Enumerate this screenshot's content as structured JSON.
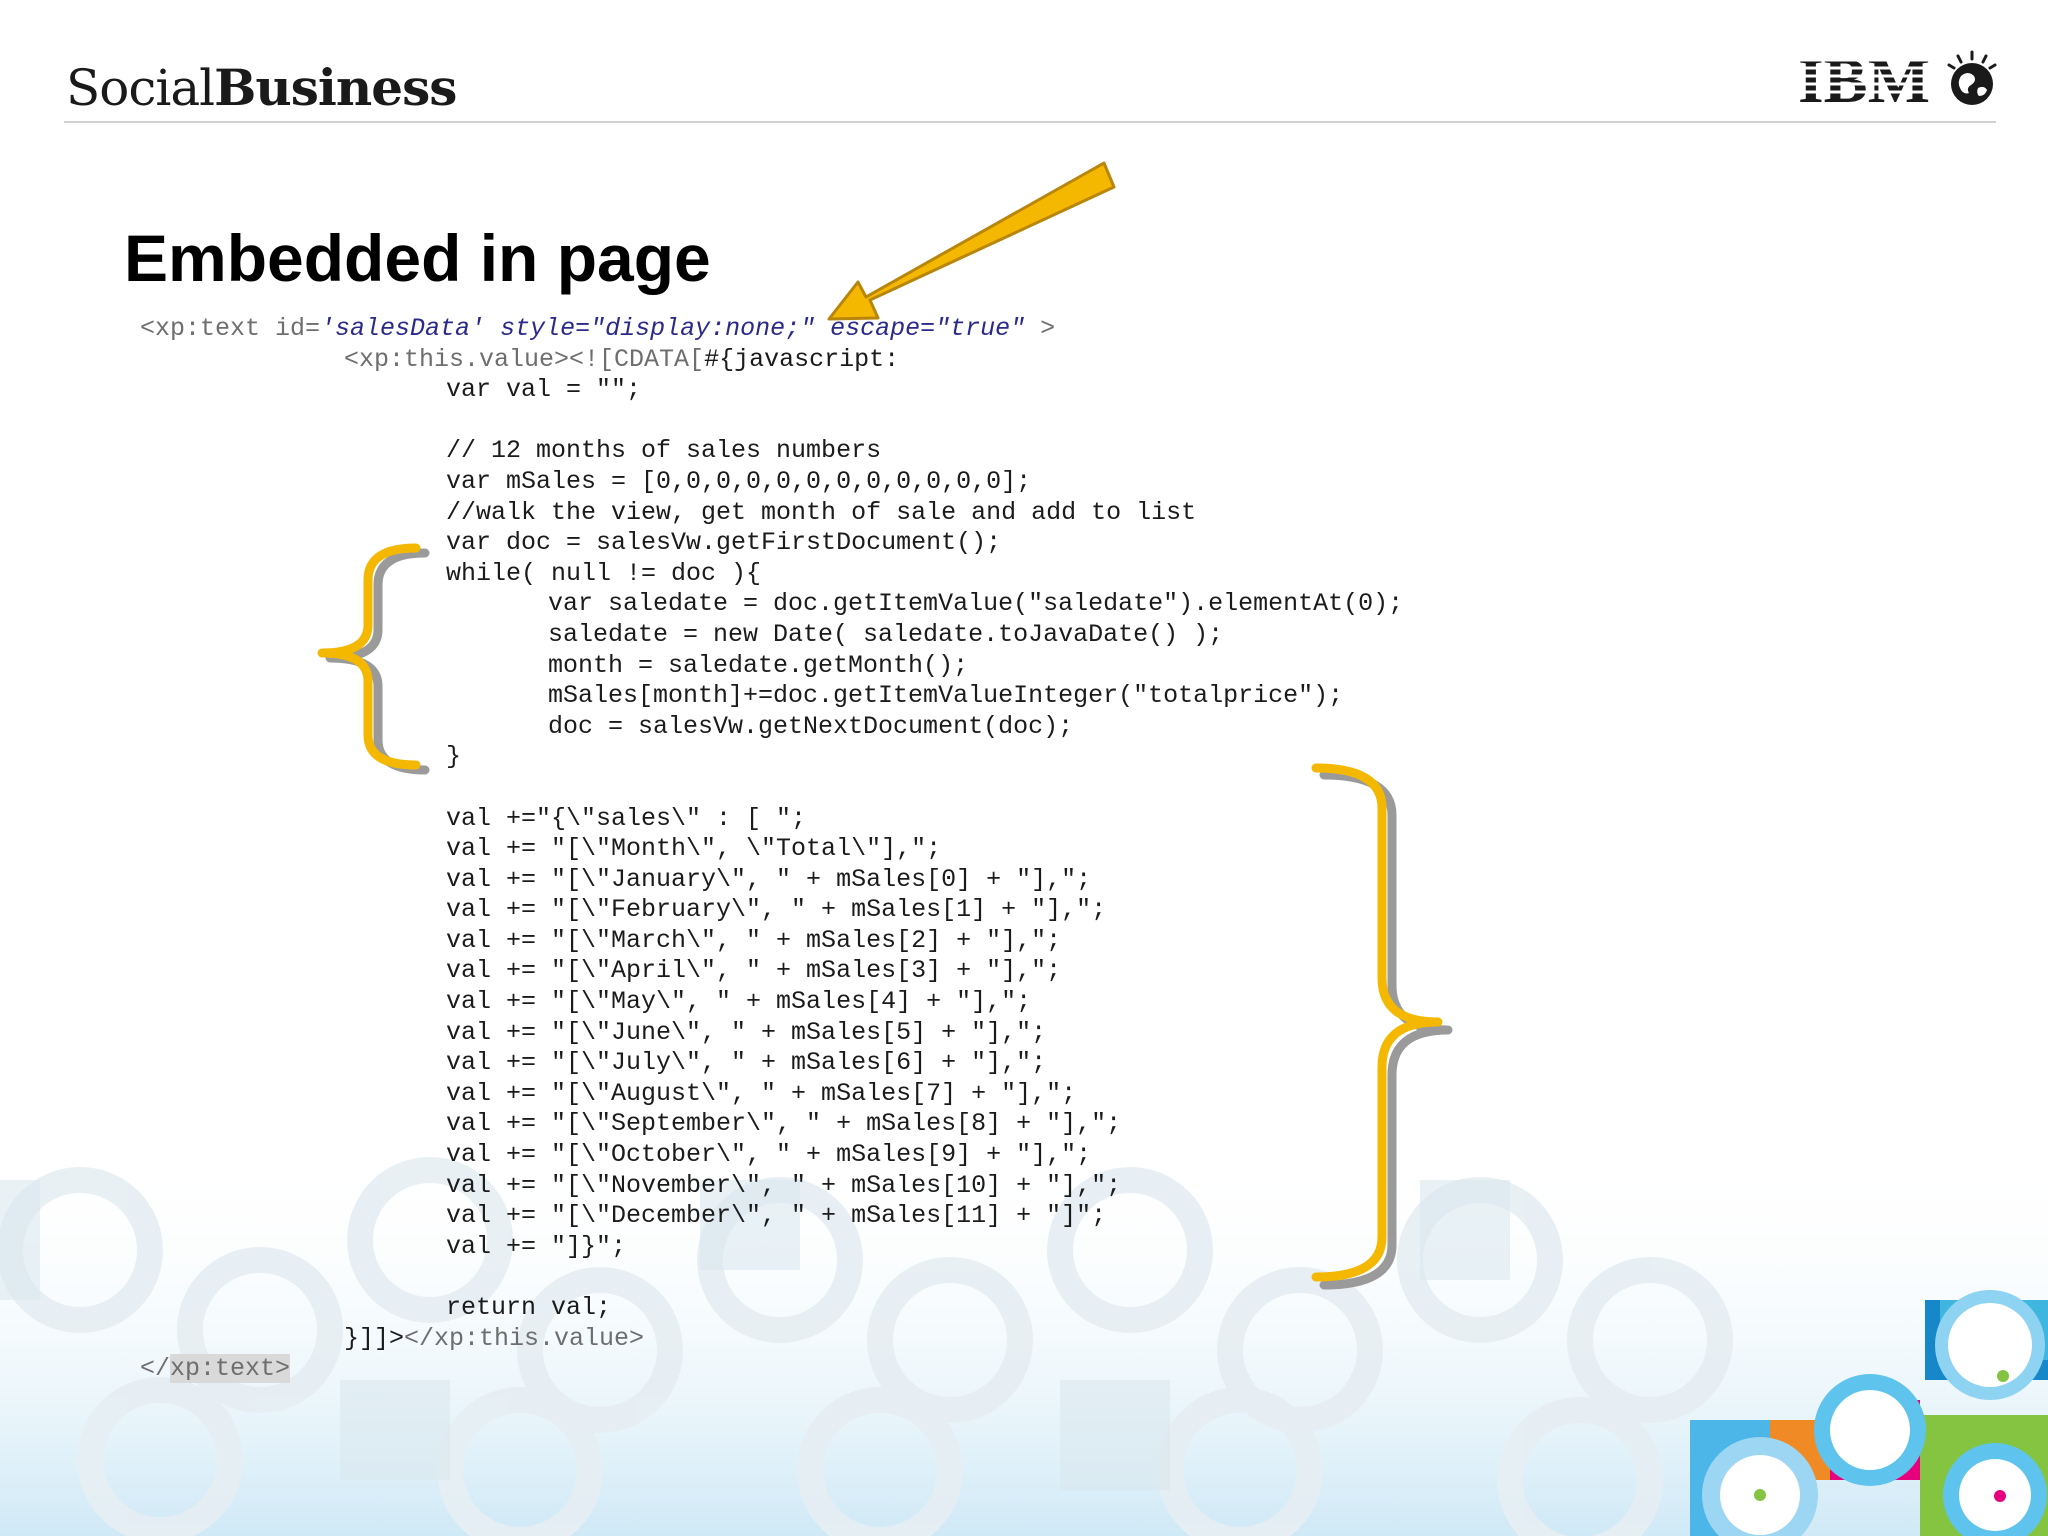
{
  "header": {
    "brand_light": "Social",
    "brand_bold": "Business",
    "logo": "IBM"
  },
  "slide": {
    "title": "Embedded in page"
  },
  "code": {
    "line1": {
      "tag_open": "<xp:text id=",
      "id_value": "'salesData'",
      "style_attr": " style=\"display:none;\" escape=\"true\"",
      "tag_close": " >"
    },
    "line2": {
      "xml": "<xp:this.value><![CDATA[",
      "script": "#{javascript:"
    },
    "lines": [
      "var val = \"\";",
      "",
      "// 12 months of sales numbers",
      "var mSales = [0,0,0,0,0,0,0,0,0,0,0,0];",
      "//walk the view, get month of sale and add to list",
      "var doc = salesVw.getFirstDocument();",
      "while( null != doc ){",
      "var saledate = doc.getItemValue(\"saledate\").elementAt(0);",
      "saledate = new Date( saledate.toJavaDate() );",
      "month = saledate.getMonth();",
      "mSales[month]+=doc.getItemValueInteger(\"totalprice\");",
      "doc = salesVw.getNextDocument(doc);",
      "}",
      "",
      "val +=\"{\\\"sales\\\" : [ \";",
      "val += \"[\\\"Month\\\", \\\"Total\\\"],\";",
      "val += \"[\\\"January\\\", \" + mSales[0] + \"],\";",
      "val += \"[\\\"February\\\", \" + mSales[1] + \"],\";",
      "val += \"[\\\"March\\\", \" + mSales[2] + \"],\";",
      "val += \"[\\\"April\\\", \" + mSales[3] + \"],\";",
      "val += \"[\\\"May\\\", \" + mSales[4] + \"],\";",
      "val += \"[\\\"June\\\", \" + mSales[5] + \"],\";",
      "val += \"[\\\"July\\\", \" + mSales[6] + \"],\";",
      "val += \"[\\\"August\\\", \" + mSales[7] + \"],\";",
      "val += \"[\\\"September\\\", \" + mSales[8] + \"],\";",
      "val += \"[\\\"October\\\", \" + mSales[9] + \"],\";",
      "val += \"[\\\"November\\\", \" + mSales[10] + \"],\";",
      "val += \"[\\\"December\\\", \" + mSales[11] + \"]\";",
      "val += \"]}\";",
      "",
      "return val;"
    ],
    "closing_line": {
      "script": "}]]>",
      "xml": "</xp:this.value>"
    },
    "end_tag": {
      "lt": "</",
      "name": "xp:text>"
    }
  },
  "colors": {
    "accent_yellow": "#f5b800",
    "bracket_shadow": "#9a9a9a",
    "xml_gray": "#6e6e6e"
  }
}
